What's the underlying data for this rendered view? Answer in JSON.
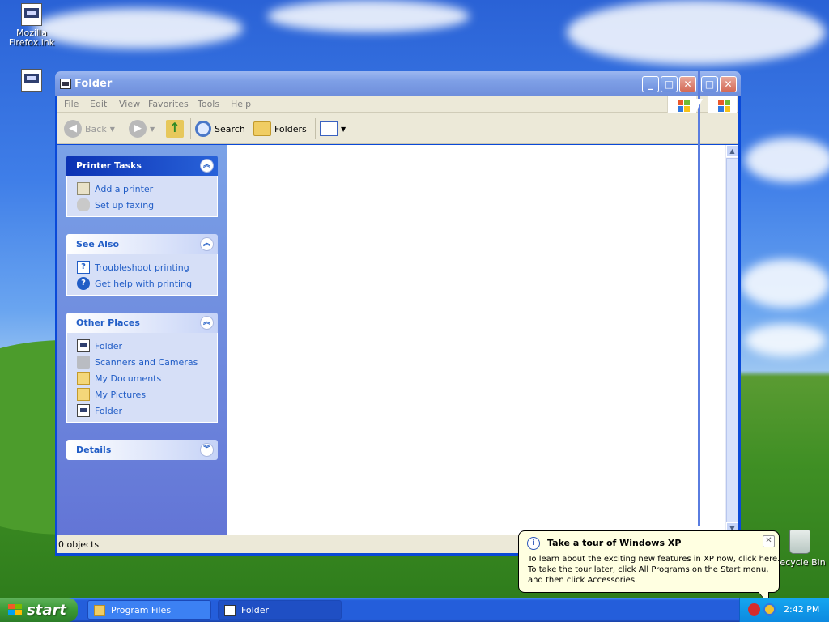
{
  "desktop": {
    "icons": [
      {
        "label": "Mozilla\nFirefox.lnk",
        "icon": "shortcut-file-icon"
      },
      {
        "label": "",
        "icon": "shortcut-file-icon"
      }
    ],
    "recycle_bin_label": "Recycle Bin"
  },
  "window": {
    "title": "Folder",
    "menu": [
      "File",
      "Edit",
      "View",
      "Favorites",
      "Tools",
      "Help"
    ],
    "toolbar": {
      "back": "Back",
      "search": "Search",
      "folders": "Folders"
    },
    "task_pane": {
      "printer_tasks": {
        "title": "Printer Tasks",
        "links": [
          {
            "label": "Add a printer",
            "icon": "add-printer-icon"
          },
          {
            "label": "Set up faxing",
            "icon": "fax-icon"
          }
        ]
      },
      "see_also": {
        "title": "See Also",
        "links": [
          {
            "label": "Troubleshoot printing",
            "icon": "help-book-icon"
          },
          {
            "label": "Get help with printing",
            "icon": "help-icon"
          }
        ]
      },
      "other_places": {
        "title": "Other Places",
        "links": [
          {
            "label": "Folder",
            "icon": "folder-window-icon"
          },
          {
            "label": "Scanners and Cameras",
            "icon": "scanner-icon"
          },
          {
            "label": "My Documents",
            "icon": "my-documents-icon"
          },
          {
            "label": "My Pictures",
            "icon": "my-pictures-icon"
          },
          {
            "label": "Folder",
            "icon": "folder-window-icon"
          }
        ]
      },
      "details": {
        "title": "Details"
      }
    },
    "status": "0 objects"
  },
  "balloon": {
    "title": "Take a tour of Windows XP",
    "lines": [
      "To learn about the exciting new features in XP now, click here.",
      "To take the tour later, click All Programs on the Start menu,",
      "and then click Accessories."
    ]
  },
  "taskbar": {
    "start": "start",
    "tasks": [
      {
        "label": "Program Files",
        "icon": "folder-icon"
      },
      {
        "label": "Folder",
        "icon": "folder-window-icon"
      }
    ],
    "clock": "2:42 PM"
  },
  "colors": {
    "titlebar": "#7e9fe6",
    "taskpane_link": "#215dc6",
    "taskbar": "#245edb",
    "start_button": "#3a9a35",
    "balloon": "#ffffe1"
  }
}
